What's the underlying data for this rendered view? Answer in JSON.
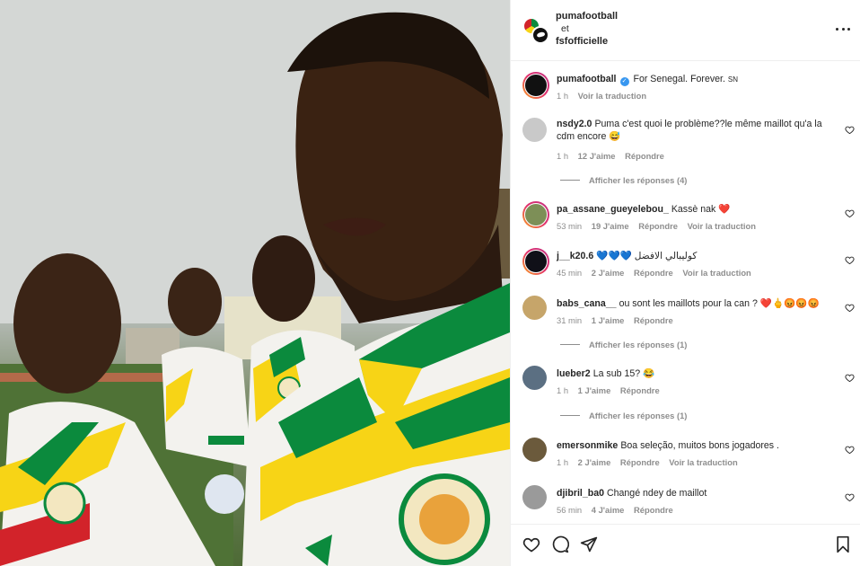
{
  "post": {
    "author": "pumafootball",
    "collab_word": "et",
    "coauthor": "fsfofficielle",
    "caption": "For Senegal. Forever. ",
    "caption_flag": "SN",
    "time": "1 h",
    "translate": "Voir la traduction"
  },
  "comments": [
    {
      "user": "nsdy2.0",
      "text": "Puma c'est quoi le problème??le même maillot qu'a la cdm encore",
      "emoji": "😅",
      "time": "1 h",
      "likes": "12 J'aime",
      "reply": "Répondre",
      "translate": "",
      "view_replies": "Afficher les réponses (4)"
    },
    {
      "user": "pa_assane_gueyelebou_",
      "text": "Kassè nak",
      "emoji": "❤️",
      "time": "53 min",
      "likes": "19 J'aime",
      "reply": "Répondre",
      "translate": "Voir la traduction",
      "view_replies": ""
    },
    {
      "user": "j__k20.6",
      "text": "كوليبالي الافضل",
      "emoji": "💙💙💙",
      "time": "45 min",
      "likes": "2 J'aime",
      "reply": "Répondre",
      "translate": "Voir la traduction",
      "view_replies": ""
    },
    {
      "user": "babs_cana__",
      "text": "ou sont les maillots pour la can ?",
      "emoji": "❤️🖕😡😡😡",
      "time": "31 min",
      "likes": "1 J'aime",
      "reply": "Répondre",
      "translate": "",
      "view_replies": "Afficher les réponses (1)"
    },
    {
      "user": "lueber2",
      "text": "La sub 15?",
      "emoji": "😂",
      "time": "1 h",
      "likes": "1 J'aime",
      "reply": "Répondre",
      "translate": "",
      "view_replies": "Afficher les réponses (1)"
    },
    {
      "user": "emersonmike",
      "text": "Boa seleção, muitos bons jogadores .",
      "emoji": "",
      "time": "1 h",
      "likes": "2 J'aime",
      "reply": "Répondre",
      "translate": "Voir la traduction",
      "view_replies": ""
    },
    {
      "user": "djibril_ba0",
      "text": "Changé ndey de maillot",
      "emoji": "",
      "time": "56 min",
      "likes": "4 J'aime",
      "reply": "Répondre",
      "translate": "",
      "view_replies": ""
    }
  ],
  "icons": {
    "like": "heart-icon",
    "comment": "comment-icon",
    "share": "share-icon",
    "save": "bookmark-icon",
    "more": "more-icon",
    "verified": "verified-icon"
  },
  "colors": {
    "verified": "#3897f0",
    "like_red": "#ed4956",
    "jersey_green": "#0b8a3d",
    "jersey_yellow": "#f7d416"
  }
}
